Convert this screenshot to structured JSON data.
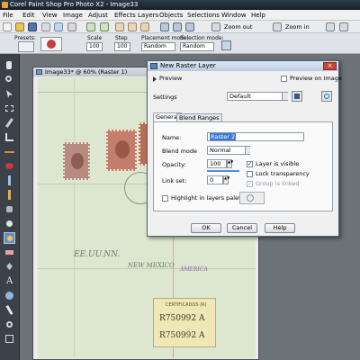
{
  "window": {
    "title": "Corel Paint Shop Pro Photo X2 - Image33"
  },
  "menu": [
    "File",
    "Edit",
    "View",
    "Image",
    "Adjust",
    "Effects",
    "Layers",
    "Objects",
    "Selections",
    "Window",
    "Help"
  ],
  "toolbar": {
    "zoom_out": "Zoom out",
    "zoom_in": "Zoom in"
  },
  "options_bar": {
    "presets_label": "Presets:",
    "scale_label": "Scale",
    "scale_value": "100",
    "step_label": "Step",
    "step_value": "100",
    "placement_label": "Placement mode:",
    "placement_value": "Random",
    "selection_label": "Selection mode:",
    "selection_value": "Random"
  },
  "image_window": {
    "title": "Image33* @ 60% (Raster 1)",
    "document": {
      "handwriting_1": "EE.UU.NN.",
      "handwriting_2": "NEW MEXICO",
      "handwriting_3": "AMERICA",
      "label_text": "CERTIFICADOS (R)",
      "reg_number": "R750992 A",
      "reg_number_2": "R750992 A"
    }
  },
  "dialog": {
    "title": "New Raster Layer",
    "preview_label": "Preview",
    "preview_on_image": "Preview on Image",
    "settings_label": "Settings",
    "settings_value": "Default",
    "tabs": [
      "General",
      "Blend Ranges"
    ],
    "name_label": "Name:",
    "name_value": "Raster 2",
    "blend_mode_label": "Blend mode",
    "blend_mode_value": "Normal",
    "opacity_label": "Opacity:",
    "opacity_value": "100",
    "link_set_label": "Link set:",
    "link_set_value": "0",
    "layer_visible": "Layer is visible",
    "lock_transparency": "Lock transparency",
    "group_linked": "Group is linked",
    "highlight_label": "Highlight in layers palette:",
    "ok": "OK",
    "cancel": "Cancel",
    "help": "Help"
  }
}
